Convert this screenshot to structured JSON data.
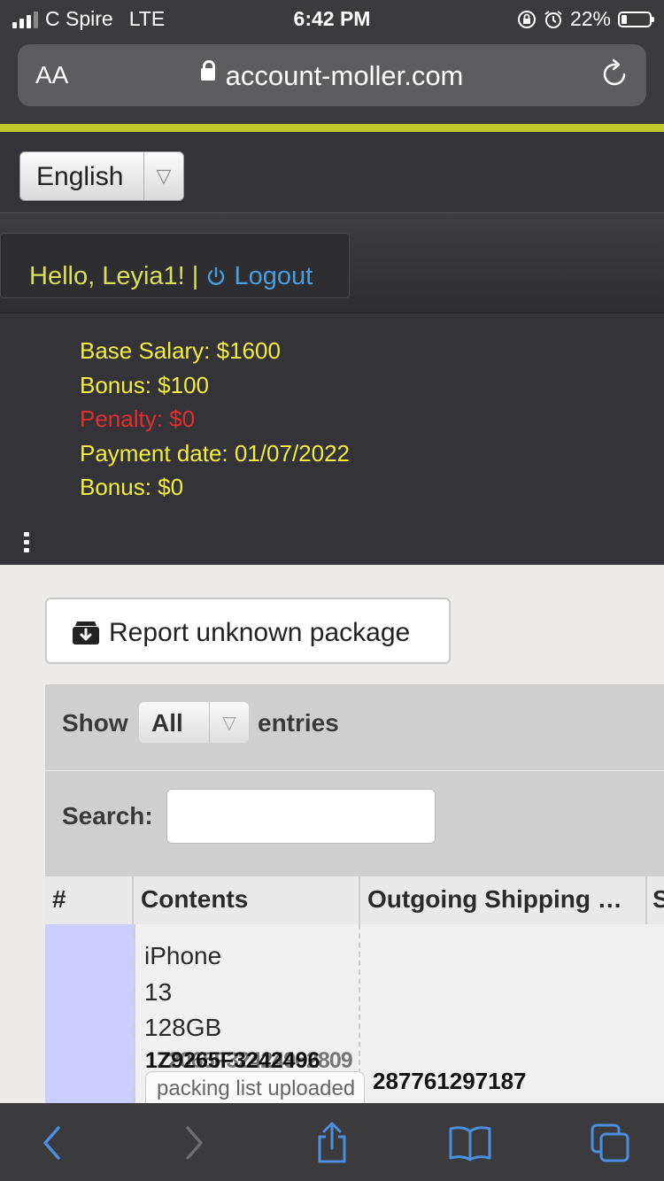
{
  "status_bar": {
    "carrier": "C Spire",
    "network": "LTE",
    "time": "6:42 PM",
    "battery": "22%"
  },
  "browser": {
    "text_size_label": "AA",
    "url": "account-moller.com"
  },
  "language_select": {
    "selected": "English"
  },
  "user_bar": {
    "greeting": "Hello, Leyia1!",
    "separator": "|",
    "logout_label": "Logout"
  },
  "salary_info": {
    "base_salary": "Base Salary: $1600",
    "bonus": "Bonus: $100",
    "penalty": "Penalty: $0",
    "payment_date": "Payment date: 01/07/2022",
    "bonus2": "Bonus: $0"
  },
  "report_button": {
    "label": "Report unknown package"
  },
  "table_controls": {
    "show_label": "Show",
    "entries_value": "All",
    "entries_label": "entries",
    "search_label": "Search:",
    "search_value": ""
  },
  "table": {
    "columns": [
      "#",
      "Contents",
      "Outgoing Shipping …",
      "S"
    ],
    "rows": [
      {
        "contents_lines": [
          "iPhone",
          "13",
          "128GB"
        ],
        "tracking_a": "1Z9265F3242496",
        "tracking_b": "172065F32424962809",
        "packing_status": "packing list uploaded",
        "outgoing_tracking": "287761297187"
      }
    ]
  },
  "colors": {
    "accent_bar": "#bcc92b",
    "dark_bg": "#333338",
    "info_text": "#f1ee3e",
    "penalty_text": "#e22e2e",
    "logout_link": "#4a9ee0",
    "row_highlight": "#ccccff",
    "toolbar_icon": "#4a8fe0"
  },
  "icons": {
    "signal": "signal-bars-icon",
    "lock": "lock-icon",
    "reload": "reload-icon",
    "power": "power-icon",
    "archive": "archive-download-icon",
    "back": "back-chevron-icon",
    "forward": "forward-chevron-icon",
    "share": "share-icon",
    "bookmarks": "bookmarks-icon",
    "tabs": "tabs-icon"
  }
}
